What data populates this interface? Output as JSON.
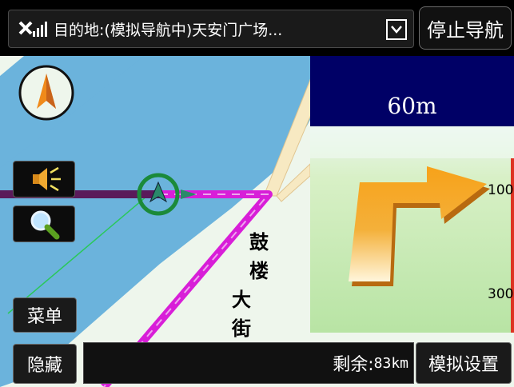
{
  "top_bar": {
    "destination_text": "目的地:(模拟导航中)天安门广场...",
    "stop_button_label": "停止导航"
  },
  "map": {
    "street_name_chars": [
      "鼓",
      "楼",
      "大",
      "街"
    ]
  },
  "guidance": {
    "distance": "60m",
    "scale_ticks": [
      "100",
      "300"
    ]
  },
  "left_controls": {
    "menu_label": "菜单",
    "hide_label": "隐藏"
  },
  "bottom_bar": {
    "remaining_label": "剩余:",
    "remaining_value": "83km",
    "sim_settings_label": "模拟设置"
  },
  "colors": {
    "river": "#6bb3dc",
    "land": "#eef6ec",
    "route": "#d81ed8",
    "route_traveled": "#5a1a5a",
    "road": "#f7e9c2",
    "guidance_header": "#000066",
    "turn_arrow": "#f09a1a"
  },
  "icons": [
    "signal-gps-icon",
    "dropdown-arrow-icon",
    "compass-north-icon",
    "speaker-icon",
    "zoom-magnifier-icon",
    "vehicle-position-icon",
    "turn-right-arrow-icon"
  ]
}
